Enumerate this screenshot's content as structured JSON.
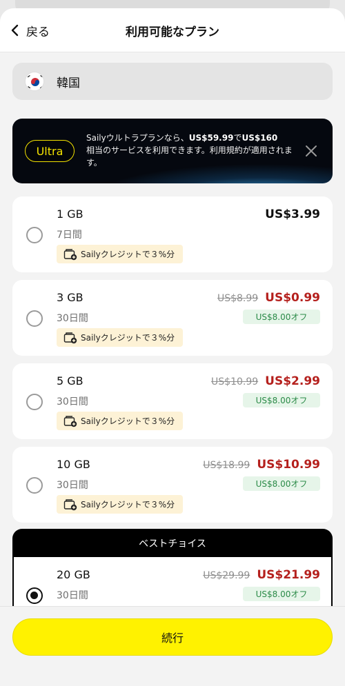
{
  "header": {
    "back_label": "戻る",
    "title": "利用可能なプラン"
  },
  "country": {
    "name": "韓国",
    "flag_icon": "south-korea-flag-icon"
  },
  "banner": {
    "badge": "Ultra",
    "text_prefix": "Sailyウルトラプランなら、",
    "price_a": "US$59.99",
    "text_mid": "で",
    "price_b": "US$160",
    "text_suffix": "相当のサービスを利用できます。利用規約が適用されます。",
    "close_icon": "close-icon"
  },
  "credit_label": "Sailyクレジットで３%分",
  "plans": [
    {
      "gb": "1 GB",
      "days": "7日間",
      "price": "US$3.99",
      "old_price": "",
      "discount": "",
      "selected": false
    },
    {
      "gb": "3 GB",
      "days": "30日間",
      "price": "US$0.99",
      "old_price": "US$8.99",
      "discount": "US$8.00オフ",
      "selected": false
    },
    {
      "gb": "5 GB",
      "days": "30日間",
      "price": "US$2.99",
      "old_price": "US$10.99",
      "discount": "US$8.00オフ",
      "selected": false
    },
    {
      "gb": "10 GB",
      "days": "30日間",
      "price": "US$10.99",
      "old_price": "US$18.99",
      "discount": "US$8.00オフ",
      "selected": false
    }
  ],
  "best_choice": {
    "label": "ベストチョイス",
    "gb": "20 GB",
    "days": "30日間",
    "price": "US$21.99",
    "old_price": "US$29.99",
    "discount": "US$8.00オフ",
    "selected": true
  },
  "footer": {
    "continue_label": "続行"
  },
  "colors": {
    "accent_yellow": "#fff200",
    "sale_red": "#b5201d",
    "discount_green": "#2a8a47"
  }
}
